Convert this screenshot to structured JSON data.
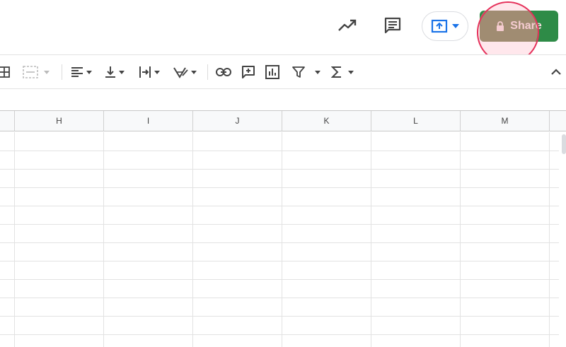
{
  "header": {
    "share_label": "Share",
    "activity_icon": "trending-up-icon",
    "comments_icon": "comment-icon",
    "present_icon": "present-upload-icon",
    "share_icon": "lock-icon",
    "share_color": "#2e8b47"
  },
  "toolbar": {
    "icons": [
      "borders-icon",
      "merge-cells-icon",
      "align-left-icon",
      "vertical-align-bottom-icon",
      "text-wrap-icon",
      "text-rotation-icon",
      "insert-link-icon",
      "insert-comment-icon",
      "insert-chart-icon",
      "filter-icon",
      "functions-icon",
      "collapse-chevron-icon"
    ]
  },
  "sheet": {
    "columns": [
      "H",
      "I",
      "J",
      "K",
      "L",
      "M"
    ]
  }
}
